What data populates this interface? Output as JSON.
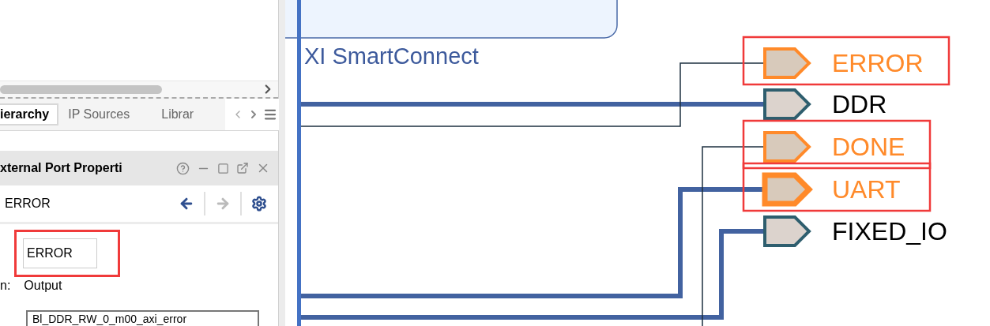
{
  "sources_panel": {
    "tabs": [
      {
        "label": "ierarchy",
        "selected": true
      },
      {
        "label": "IP Sources",
        "selected": false
      },
      {
        "label": "Librar",
        "selected": false
      }
    ]
  },
  "properties_panel": {
    "title": "xternal Port Properti",
    "object_name": "ERROR",
    "name_field": {
      "value": "ERROR",
      "annotated": true
    },
    "direction_label": "n:",
    "direction_value": "Output",
    "connection": "Bl_DDR_RW_0_m00_axi_error"
  },
  "diagram": {
    "block_label": "XI SmartConnect",
    "ports": [
      {
        "name": "ERROR",
        "highlighted": true,
        "selected": false,
        "annotated": true
      },
      {
        "name": "DDR",
        "highlighted": false,
        "selected": false,
        "annotated": false
      },
      {
        "name": "DONE",
        "highlighted": true,
        "selected": false,
        "annotated": true
      },
      {
        "name": "UART",
        "highlighted": true,
        "selected": true,
        "annotated": true
      },
      {
        "name": "FIXED_IO",
        "highlighted": false,
        "selected": false,
        "annotated": false
      }
    ]
  }
}
